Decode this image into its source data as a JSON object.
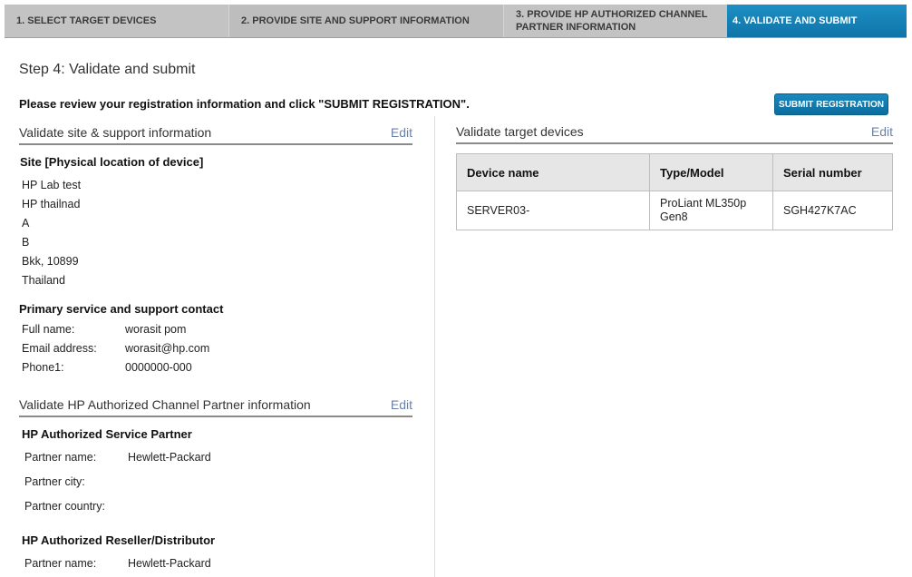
{
  "steps": [
    {
      "label": "1. SELECT TARGET DEVICES"
    },
    {
      "label": "2. PROVIDE SITE AND SUPPORT INFORMATION"
    },
    {
      "label": "3. PROVIDE HP AUTHORIZED CHANNEL PARTNER INFORMATION"
    },
    {
      "label": "4. VALIDATE AND SUBMIT"
    }
  ],
  "page": {
    "title": "Step 4: Validate and submit",
    "review_text": "Please review your registration information and click \"SUBMIT REGISTRATION\".",
    "submit_label": "SUBMIT REGISTRATION"
  },
  "site_section": {
    "title": "Validate site & support information",
    "edit": "Edit",
    "site_heading": "Site [Physical location of device]",
    "site_lines": [
      "HP Lab test",
      "HP thailnad",
      "A",
      "B",
      "Bkk, 10899",
      "Thailand"
    ],
    "contact_heading": "Primary service and support contact",
    "contact": [
      {
        "label": "Full name:",
        "value": "worasit pom"
      },
      {
        "label": "Email address:",
        "value": "worasit@hp.com"
      },
      {
        "label": "Phone1:",
        "value": "0000000-000"
      }
    ]
  },
  "partner_section": {
    "title": "Validate HP Authorized Channel Partner information",
    "edit": "Edit",
    "service_heading": "HP Authorized Service Partner",
    "service": [
      {
        "label": "Partner name:",
        "value": "Hewlett-Packard"
      },
      {
        "label": "Partner city:",
        "value": ""
      },
      {
        "label": "Partner country:",
        "value": ""
      }
    ],
    "reseller_heading": "HP Authorized Reseller/Distributor",
    "reseller": [
      {
        "label": "Partner name:",
        "value": "Hewlett-Packard"
      }
    ]
  },
  "devices_section": {
    "title": "Validate target devices",
    "edit": "Edit",
    "columns": [
      "Device name",
      "Type/Model",
      "Serial number"
    ],
    "rows": [
      {
        "device": "SERVER03-",
        "model": "ProLiant ML350p Gen8",
        "serial": "SGH427K7AC"
      }
    ]
  },
  "colors": {
    "active_step": "#1382b8",
    "button": "#0f78ab",
    "edit_link": "#6b82a8"
  }
}
